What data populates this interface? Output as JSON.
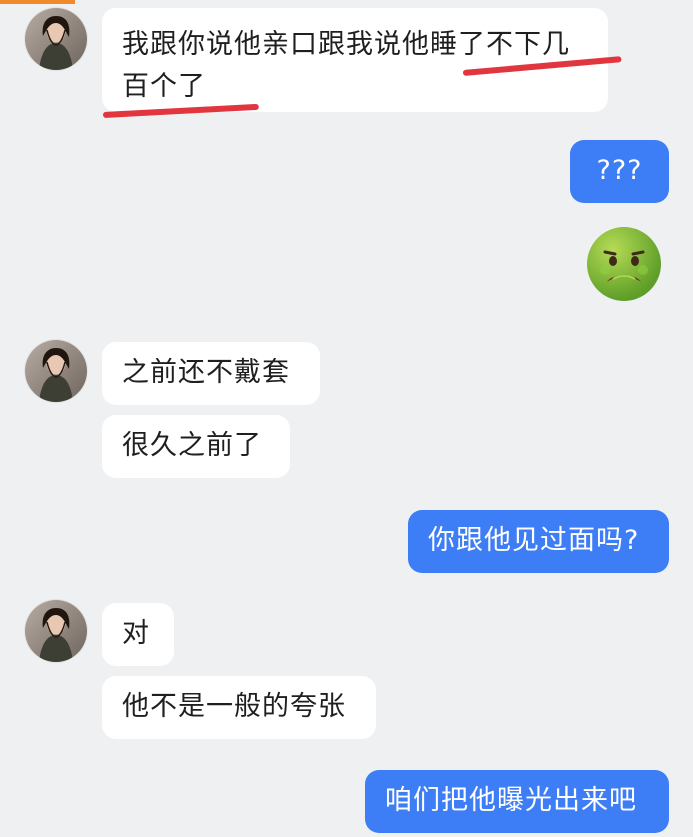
{
  "messages": [
    {
      "id": "m1",
      "side": "incoming",
      "lines": [
        "我跟你说他亲口跟我说他睡了不下几",
        "百个了"
      ]
    },
    {
      "id": "m2",
      "side": "outgoing",
      "text": "???"
    },
    {
      "id": "m3",
      "side": "outgoing",
      "emoji": "nauseated-face"
    },
    {
      "id": "m4",
      "side": "incoming",
      "text": "之前还不戴套"
    },
    {
      "id": "m5",
      "side": "incoming",
      "text": "很久之前了"
    },
    {
      "id": "m6",
      "side": "outgoing",
      "text": "你跟他见过面吗?"
    },
    {
      "id": "m7",
      "side": "incoming",
      "text": "对"
    },
    {
      "id": "m8",
      "side": "incoming",
      "text": "他不是一般的夸张"
    },
    {
      "id": "m9",
      "side": "outgoing",
      "text": "咱们把他曝光出来吧"
    }
  ],
  "colors": {
    "background": "#eef0f2",
    "incoming_bubble": "#ffffff",
    "outgoing_bubble": "#3d7df6",
    "highlight_underline": "#e2363e"
  },
  "icons": {
    "avatar": "contact-avatar-icon",
    "emoji": "nauseated-face-icon"
  }
}
